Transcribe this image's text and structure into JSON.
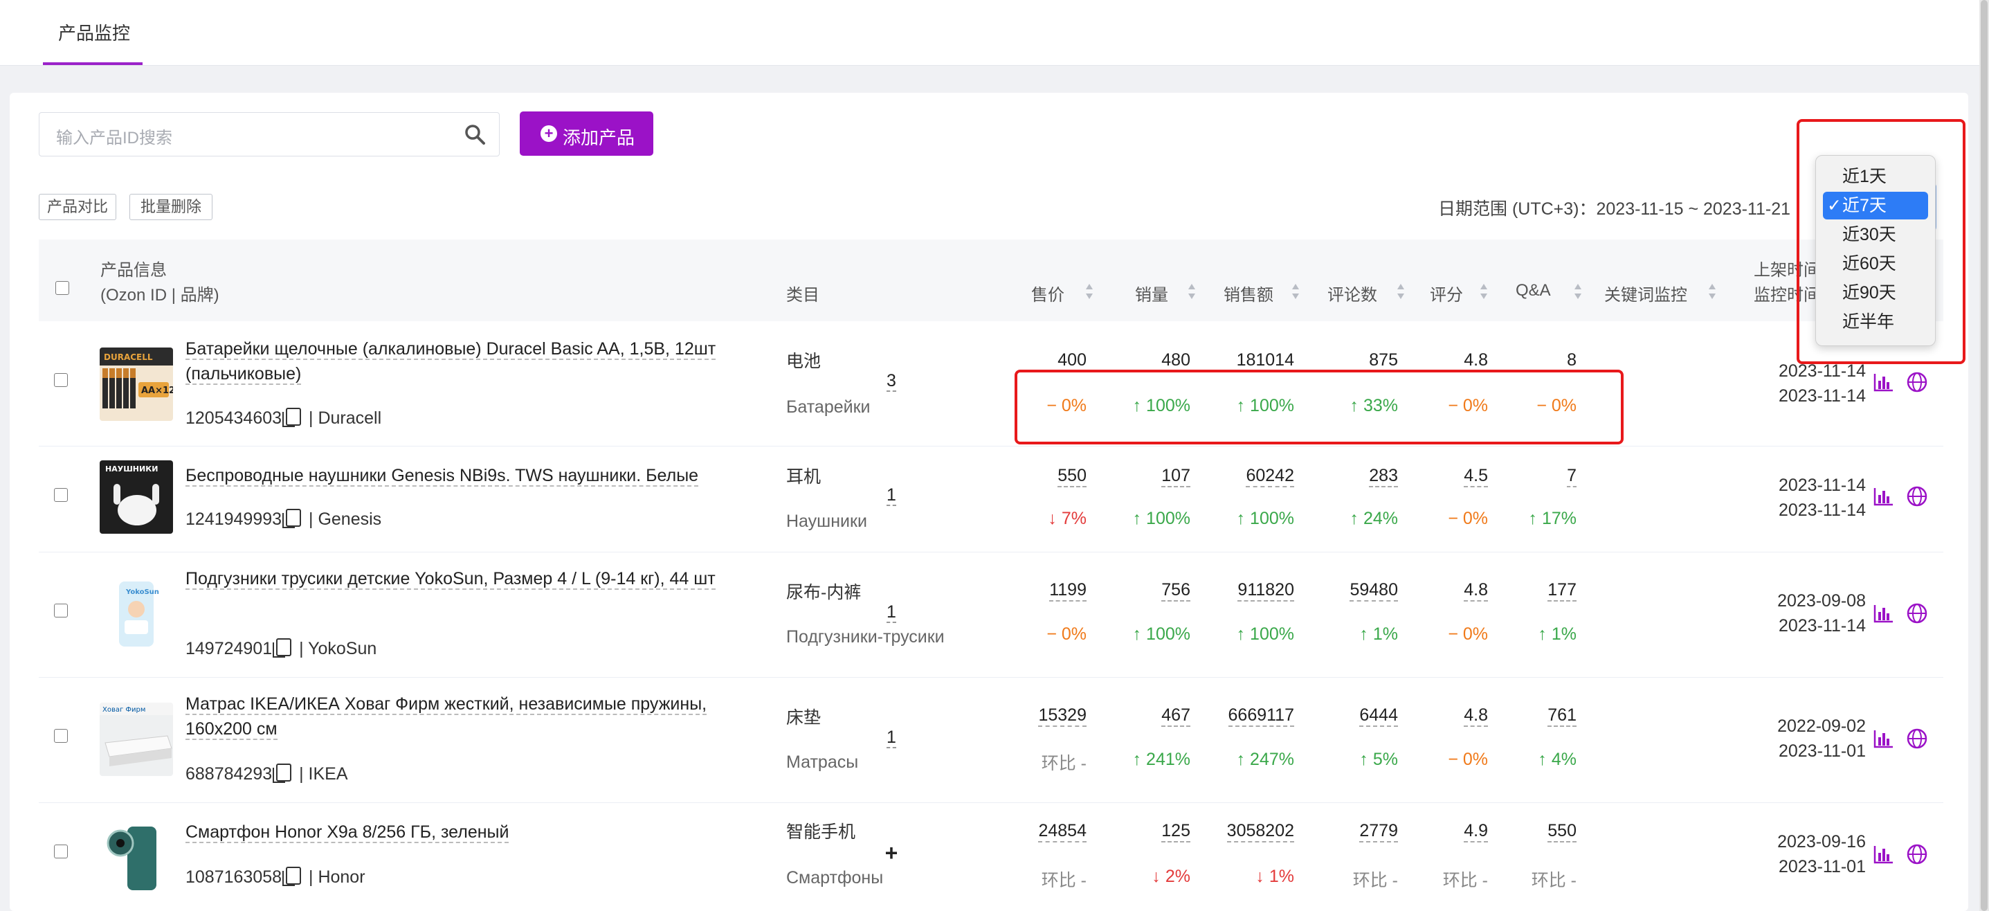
{
  "tabs": [
    {
      "label": "产品监控"
    }
  ],
  "search": {
    "placeholder": "输入产品ID搜索"
  },
  "toolbar": {
    "add_label": "添加产品",
    "compare_label": "产品对比",
    "batch_delete_label": "批量删除"
  },
  "date_range": {
    "label": "日期范围 (UTC+3)：",
    "value": "2023-11-15 ~ 2023-11-21"
  },
  "period_dropdown": {
    "options": [
      "近1天",
      "近7天",
      "近30天",
      "近60天",
      "近90天",
      "近半年"
    ],
    "selected": "近7天",
    "check_mark": "✓"
  },
  "table": {
    "headers": {
      "product_info_line1": "产品信息",
      "product_info_line2": "(Ozon ID | 品牌)",
      "category": "类目",
      "price": "售价",
      "sales": "销量",
      "revenue": "销售额",
      "reviews": "评论数",
      "rating": "评分",
      "qa": "Q&A",
      "keyword": "关键词监控",
      "listed_line1": "上架时间",
      "listed_line2": "监控时间"
    },
    "rows": [
      {
        "name": "Батарейки щелочные (алкалиновые) Duracel Basic AA, 1,5В, 12шт (пальчиковые)",
        "id": "1205434603",
        "brand": "| Duracell",
        "cat_cn": "电池",
        "cat_ru": "Батарейки",
        "price": "400",
        "sales": "480",
        "revenue": "181014",
        "reviews": "875",
        "rating": "4.8",
        "qa": "8",
        "price_chg": "− 0%",
        "sales_chg": "↑ 100%",
        "revenue_chg": "↑ 100%",
        "reviews_chg": "↑ 33%",
        "rating_chg": "− 0%",
        "qa_chg": "− 0%",
        "keyword": "3",
        "listed": "2023-11-14",
        "monitored": "2023-11-14"
      },
      {
        "name": "Беспроводные наушники Genesis NBi9s. TWS наушники. Белые",
        "id": "1241949993",
        "brand": "| Genesis",
        "cat_cn": "耳机",
        "cat_ru": "Наушники",
        "price": "550",
        "sales": "107",
        "revenue": "60242",
        "reviews": "283",
        "rating": "4.5",
        "qa": "7",
        "price_chg": "↓ 7%",
        "sales_chg": "↑ 100%",
        "revenue_chg": "↑ 100%",
        "reviews_chg": "↑ 24%",
        "rating_chg": "− 0%",
        "qa_chg": "↑ 17%",
        "keyword": "1",
        "listed": "2023-11-14",
        "monitored": "2023-11-14"
      },
      {
        "name": "Подгузники трусики детские YokoSun, Размер 4 / L (9-14 кг), 44 шт",
        "id": "149724901",
        "brand": "| YokoSun",
        "cat_cn": "尿布-内裤",
        "cat_ru": "Подгузники-трусики",
        "price": "1199",
        "sales": "756",
        "revenue": "911820",
        "reviews": "59480",
        "rating": "4.8",
        "qa": "177",
        "price_chg": "− 0%",
        "sales_chg": "↑ 100%",
        "revenue_chg": "↑ 100%",
        "reviews_chg": "↑ 1%",
        "rating_chg": "− 0%",
        "qa_chg": "↑ 1%",
        "keyword": "1",
        "listed": "2023-09-08",
        "monitored": "2023-11-14"
      },
      {
        "name": "Матрас IKEA/ИКЕА Ховаг Фирм жесткий, независимые пружины, 160x200 см",
        "id": "688784293",
        "brand": "| IKEA",
        "cat_cn": "床垫",
        "cat_ru": "Матрасы",
        "price": "15329",
        "sales": "467",
        "revenue": "6669117",
        "reviews": "6444",
        "rating": "4.8",
        "qa": "761",
        "price_chg": "环比 -",
        "sales_chg": "↑ 241%",
        "revenue_chg": "↑ 247%",
        "reviews_chg": "↑ 5%",
        "rating_chg": "− 0%",
        "qa_chg": "↑ 4%",
        "keyword": "1",
        "listed": "2022-09-02",
        "monitored": "2023-11-01"
      },
      {
        "name": "Смартфон Honor X9a 8/256 ГБ, зеленый",
        "id": "1087163058",
        "brand": "| Honor",
        "cat_cn": "智能手机",
        "cat_ru": "Смартфоны",
        "price": "24854",
        "sales": "125",
        "revenue": "3058202",
        "reviews": "2779",
        "rating": "4.9",
        "qa": "550",
        "price_chg": "环比 -",
        "sales_chg": "↓ 2%",
        "revenue_chg": "↓ 1%",
        "reviews_chg": "环比 -",
        "rating_chg": "环比 -",
        "qa_chg": "环比 -",
        "keyword": "+",
        "listed": "2023-09-16",
        "monitored": "2023-11-01"
      }
    ]
  },
  "colors": {
    "accent": "#9b12c7",
    "up": "#3aa84a",
    "down": "#e33b3b",
    "flat": "#f07a1a",
    "annotation": "#e8191b",
    "selected_option": "#2d7cf6"
  }
}
